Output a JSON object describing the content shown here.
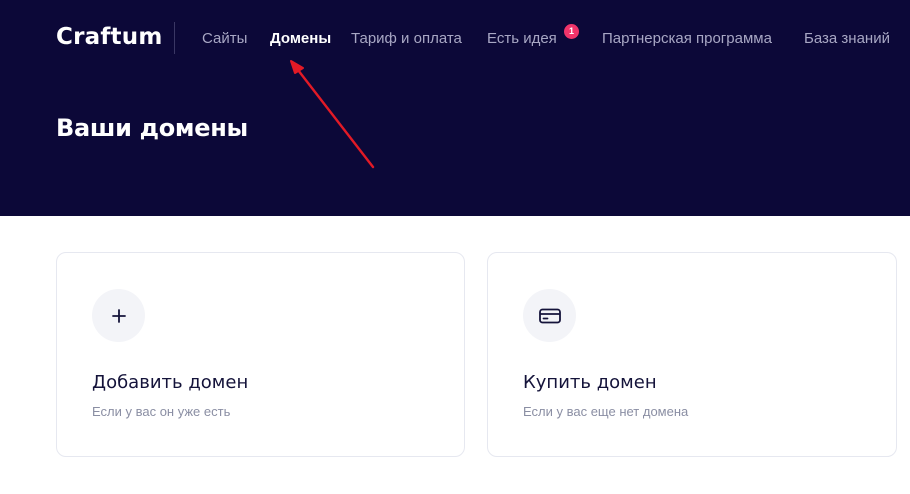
{
  "header": {
    "logo": "Craftum",
    "nav": [
      {
        "label": "Сайты",
        "active": false
      },
      {
        "label": "Домены",
        "active": true
      },
      {
        "label": "Тариф и оплата",
        "active": false
      },
      {
        "label": "Есть идея",
        "active": false,
        "badge": "1"
      },
      {
        "label": "Партнерская программа",
        "active": false
      },
      {
        "label": "База знаний",
        "active": false
      }
    ],
    "page_title": "Ваши домены"
  },
  "cards": [
    {
      "icon": "plus-icon",
      "title": "Добавить домен",
      "subtitle": "Если у вас он уже есть"
    },
    {
      "icon": "credit-card-icon",
      "title": "Купить домен",
      "subtitle": "Если у вас еще нет домена"
    }
  ],
  "colors": {
    "header_bg": "#0c0838",
    "accent_red": "#e21a26",
    "badge": "#f0346a"
  }
}
